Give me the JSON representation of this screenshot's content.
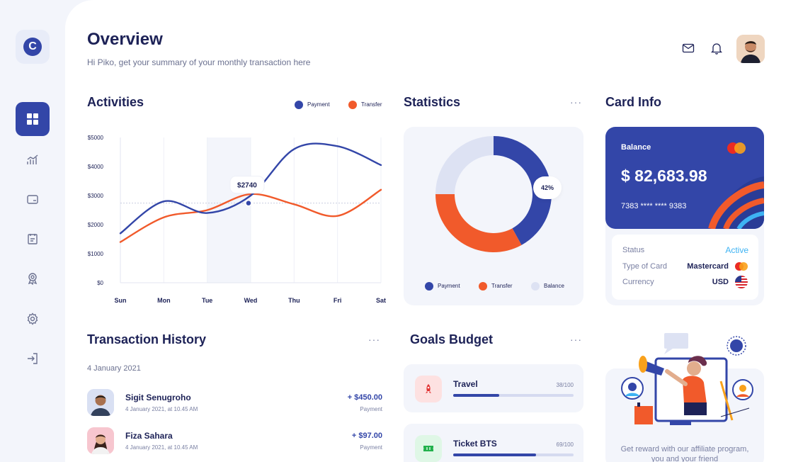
{
  "header": {
    "title": "Overview",
    "subtitle": "Hi Piko, get your summary of your monthly transaction here"
  },
  "sidebar": {
    "logo_letter": "C",
    "items": [
      {
        "name": "dashboard"
      },
      {
        "name": "analytics"
      },
      {
        "name": "wallet"
      },
      {
        "name": "invoice"
      },
      {
        "name": "rewards"
      },
      {
        "name": "settings"
      },
      {
        "name": "logout"
      }
    ]
  },
  "activities": {
    "title": "Activities",
    "legend": [
      "Payment",
      "Transfer"
    ],
    "tooltip": "$2740"
  },
  "chart_data": {
    "type": "line",
    "categories": [
      "Sun",
      "Mon",
      "Tue",
      "Wed",
      "Thu",
      "Fri",
      "Sat"
    ],
    "yticks": [
      "$5000",
      "$4000",
      "$3000",
      "$2000",
      "$1000",
      "$0"
    ],
    "ylim": [
      0,
      5000
    ],
    "series": [
      {
        "name": "Payment",
        "color": "#3346a8",
        "values": [
          1700,
          2800,
          2400,
          3000,
          4600,
          4700,
          4050
        ]
      },
      {
        "name": "Transfer",
        "color": "#f15a2b",
        "values": [
          1400,
          2250,
          2500,
          3050,
          2700,
          2300,
          3200
        ]
      }
    ],
    "highlight_category": "Wed",
    "highlight_value": 2740
  },
  "statistics": {
    "title": "Statistics",
    "more": "···",
    "percent_label": "42%",
    "legend": [
      "Payment",
      "Transfer",
      "Balance"
    ],
    "donut": [
      {
        "name": "Payment",
        "value": 42,
        "color": "#3346a8"
      },
      {
        "name": "Transfer",
        "value": 33,
        "color": "#f15a2b"
      },
      {
        "name": "Balance",
        "value": 25,
        "color": "#dde2f3"
      }
    ]
  },
  "card_info": {
    "title": "Card Info",
    "balance_label": "Balance",
    "balance": "$ 82,683.98",
    "card_number": "7383 **** **** 9383",
    "status_label": "Status",
    "status_value": "Active",
    "type_label": "Type of Card",
    "type_value": "Mastercard",
    "currency_label": "Currency",
    "currency_value": "USD",
    "status_color": "#3eb3f3"
  },
  "transactions": {
    "title": "Transaction History",
    "more": "···",
    "date_group": "4 January 2021",
    "items": [
      {
        "name": "Sigit Senugroho",
        "date": "4 January 2021, at 10.45 AM",
        "amount": "+ $450.00",
        "type": "Payment"
      },
      {
        "name": "Fiza Sahara",
        "date": "4 January 2021, at 10.45 AM",
        "amount": "+ $97.00",
        "type": "Payment"
      }
    ]
  },
  "goals": {
    "title": "Goals Budget",
    "more": "···",
    "items": [
      {
        "label": "Travel",
        "progress": "38/100",
        "fraction": 0.38
      },
      {
        "label": "Ticket BTS",
        "progress": "69/100",
        "fraction": 0.69
      }
    ]
  },
  "promo": {
    "text": "Get reward with our affiliate program, you and your friend"
  }
}
